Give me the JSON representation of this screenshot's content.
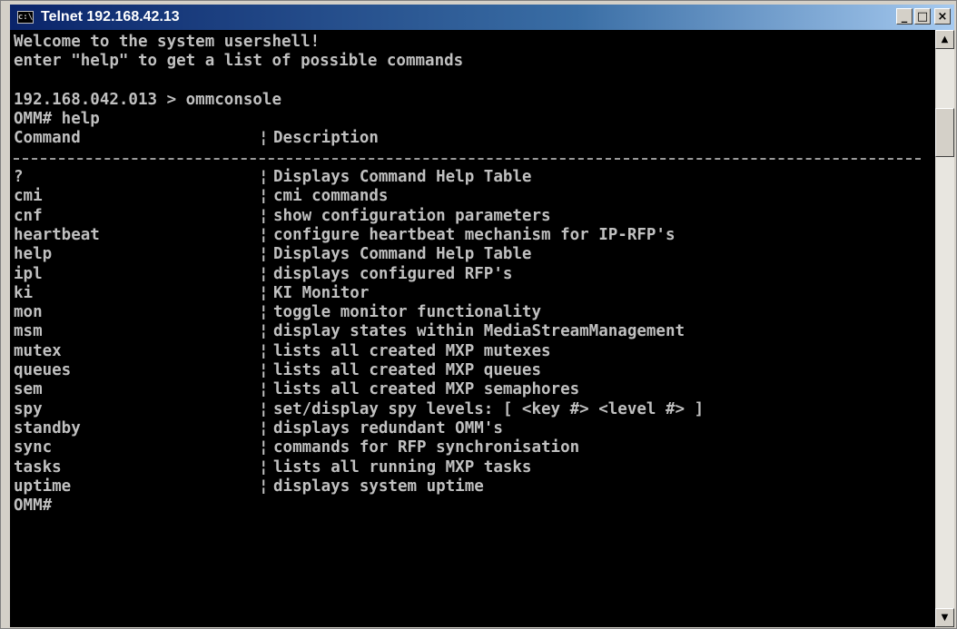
{
  "window": {
    "title": "Telnet 192.168.42.13",
    "icon": "console-icon",
    "icon_text": "c:\\",
    "minimize_label": "_",
    "maximize_label": "□",
    "close_label": "×"
  },
  "console": {
    "intro": [
      "Welcome to the system usershell!",
      "enter \"help\" to get a list of possible commands",
      "",
      "192.168.042.013 > ommconsole",
      "OMM# help"
    ],
    "header": {
      "command": "Command",
      "separator": "¦",
      "description": "Description"
    },
    "rows": [
      {
        "command": "?",
        "separator": "¦",
        "description": "Displays Command Help Table"
      },
      {
        "command": "cmi",
        "separator": "¦",
        "description": "cmi commands"
      },
      {
        "command": "cnf",
        "separator": "¦",
        "description": "show configuration parameters"
      },
      {
        "command": "heartbeat",
        "separator": "¦",
        "description": "configure heartbeat mechanism for IP-RFP's"
      },
      {
        "command": "help",
        "separator": "¦",
        "description": "Displays Command Help Table"
      },
      {
        "command": "ipl",
        "separator": "¦",
        "description": "displays configured RFP's"
      },
      {
        "command": "ki",
        "separator": "¦",
        "description": "KI Monitor"
      },
      {
        "command": "mon",
        "separator": "¦",
        "description": "toggle monitor functionality"
      },
      {
        "command": "msm",
        "separator": "¦",
        "description": "display states within MediaStreamManagement"
      },
      {
        "command": "mutex",
        "separator": "¦",
        "description": "lists all created MXP mutexes"
      },
      {
        "command": "queues",
        "separator": "¦",
        "description": "lists all created MXP queues"
      },
      {
        "command": "sem",
        "separator": "¦",
        "description": "lists all created MXP semaphores"
      },
      {
        "command": "spy",
        "separator": "¦",
        "description": "set/display spy levels: [ <key #> <level #> ]"
      },
      {
        "command": "standby",
        "separator": "¦",
        "description": "displays redundant OMM's"
      },
      {
        "command": "sync",
        "separator": "¦",
        "description": "commands for RFP synchronisation"
      },
      {
        "command": "tasks",
        "separator": "¦",
        "description": "lists all running MXP tasks"
      },
      {
        "command": "uptime",
        "separator": "¦",
        "description": "displays system uptime"
      }
    ],
    "prompt": "OMM#"
  },
  "scrollbar": {
    "up_arrow": "▲",
    "down_arrow": "▼"
  }
}
